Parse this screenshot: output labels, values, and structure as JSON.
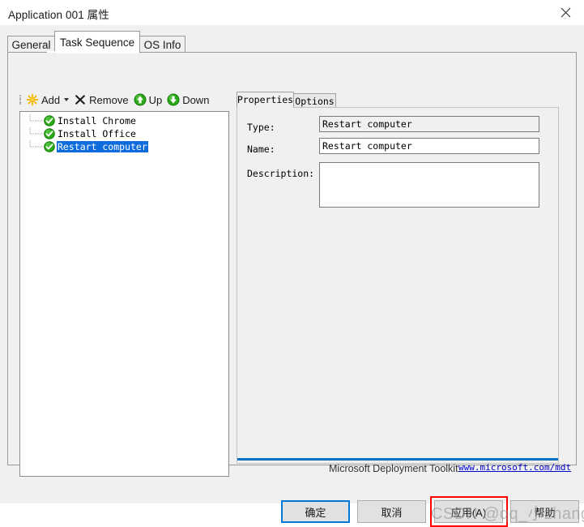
{
  "window": {
    "title": "Application 001 属性",
    "close_icon": "close-icon"
  },
  "outer_tabs": [
    {
      "label": "General",
      "active": false
    },
    {
      "label": "Task Sequence",
      "active": true
    },
    {
      "label": "OS Info",
      "active": false
    }
  ],
  "toolbar": {
    "add_label": "Add",
    "add_icon": "add-star-icon",
    "add_caret_icon": "chevron-down-icon",
    "remove_label": "Remove",
    "remove_icon": "remove-x-icon",
    "up_label": "Up",
    "up_icon": "arrow-up-circle-icon",
    "down_label": "Down",
    "down_icon": "arrow-down-circle-icon"
  },
  "tree": {
    "items": [
      {
        "label": "Install Chrome",
        "icon": "green-check-icon",
        "selected": false
      },
      {
        "label": "Install Office",
        "icon": "green-check-icon",
        "selected": false
      },
      {
        "label": "Restart computer",
        "icon": "green-check-icon",
        "selected": true
      }
    ]
  },
  "right_tabs": [
    {
      "label": "Properties",
      "active": true
    },
    {
      "label": "Options",
      "active": false
    }
  ],
  "properties": {
    "type_label": "Type:",
    "type_value": "Restart computer",
    "name_label": "Name:",
    "name_value": "Restart computer",
    "description_label": "Description:",
    "description_value": ""
  },
  "footer": {
    "brand": "Microsoft Deployment Toolkit",
    "link": "www.microsoft.com/mdt",
    "rule_color": "#0572c4"
  },
  "buttons": {
    "ok": "确定",
    "cancel": "取消",
    "apply": "应用(A)",
    "help": "帮助"
  },
  "annotation": {
    "highlight_color": "#ff0000",
    "highlight_target": "apply-button"
  },
  "watermark": {
    "text": "CSDN @qq_小zhang"
  }
}
